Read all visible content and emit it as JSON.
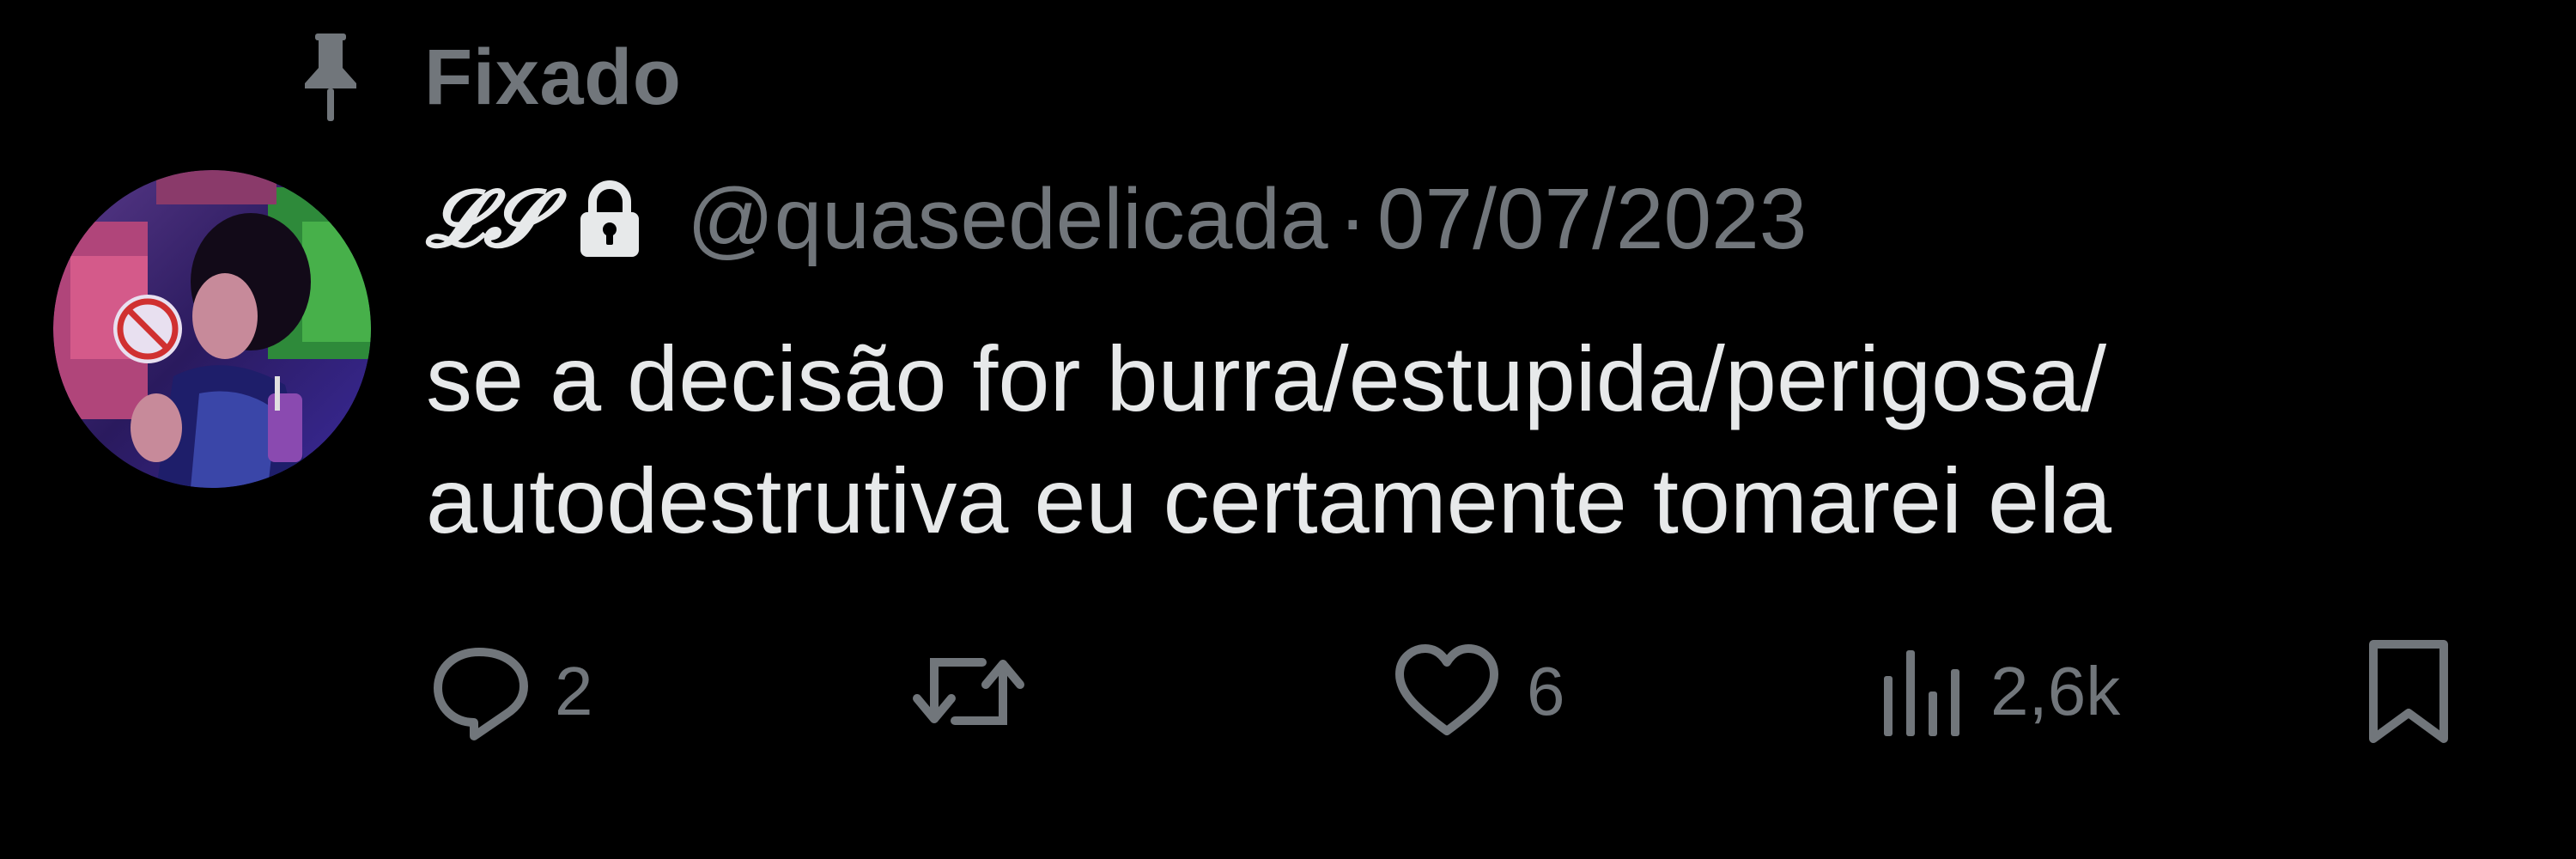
{
  "pinned": {
    "label": "Fixado",
    "icon": "pin-icon"
  },
  "tweet": {
    "author": {
      "display_name": "𝓛𝓢",
      "protected_icon": "lock-icon",
      "handle": "@quasedelicada",
      "avatar": "avatar"
    },
    "separator": "·",
    "date": "07/07/2023",
    "text_lines": [
      "se a decisão for burra/estupida/perigosa/",
      "autodestrutiva eu certamente tomarei ela"
    ]
  },
  "actions": {
    "reply": {
      "icon": "reply-icon",
      "count": "2"
    },
    "retweet": {
      "icon": "retweet-icon",
      "count": ""
    },
    "like": {
      "icon": "heart-icon",
      "count": "6"
    },
    "views": {
      "icon": "views-icon",
      "count": "2,6k"
    },
    "bookmark": {
      "icon": "bookmark-icon"
    }
  },
  "colors": {
    "background": "#000000",
    "primary_text": "#e7e9ea",
    "secondary_text": "#71767b"
  }
}
